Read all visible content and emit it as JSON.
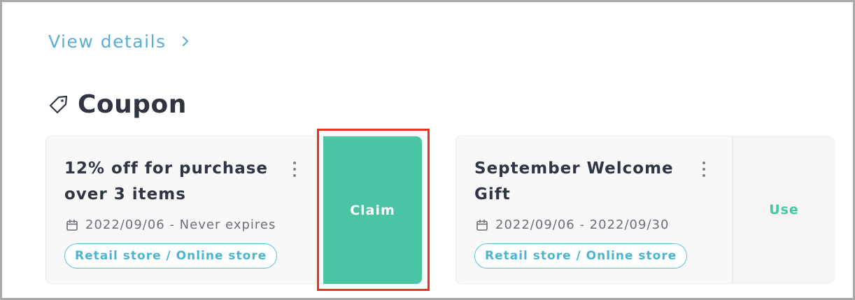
{
  "view_details": {
    "label": "View details",
    "icon": "chevron-right-icon"
  },
  "section": {
    "title": "Coupon",
    "icon": "tag-icon"
  },
  "coupons": [
    {
      "title": "12% off for purchase over 3 items",
      "date_range": "2022/09/06 - Never expires",
      "channel": "Retail store / Online store",
      "action_label": "Claim",
      "action_color": "#4ac5a3"
    },
    {
      "title": "September Welcome Gift",
      "date_range": "2022/09/06 - 2022/09/30",
      "channel": "Retail store / Online store",
      "action_label": "Use",
      "action_color": "#4ac5a3"
    }
  ],
  "colors": {
    "link": "#5aaed1",
    "accent": "#4ac5a3",
    "pill_border": "#5bc3dc",
    "highlight": "#e8321f"
  }
}
